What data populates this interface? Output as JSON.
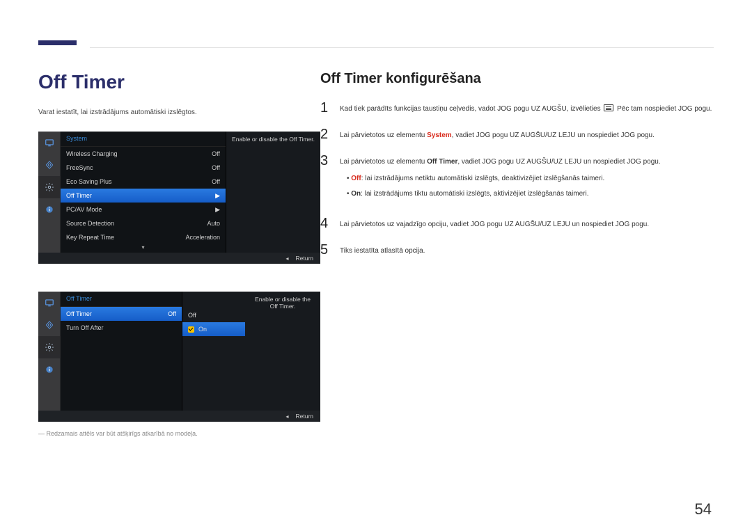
{
  "page": {
    "title": "Off Timer",
    "intro": "Varat iestatīt, lai izstrādājums automātiski izslēgtos.",
    "note": "― Redzamais attēls var būt atšķirīgs atkarībā no modeļa.",
    "page_number": "54"
  },
  "right": {
    "subtitle": "Off Timer konfigurēšana",
    "step1_a": "Kad tiek parādīts funkcijas taustiņu ceļvedis, vadot JOG pogu UZ AUGŠU, izvēlieties ",
    "step1_b": " Pēc tam nospiediet JOG pogu.",
    "step2_a": "Lai pārvietotos uz elementu ",
    "step2_sys": "System",
    "step2_b": ", vadiet JOG pogu UZ AUGŠU/UZ LEJU un nospiediet JOG pogu.",
    "step3_a": "Lai pārvietotos uz elementu ",
    "step3_item": "Off Timer",
    "step3_b": ", vadiet JOG pogu UZ AUGŠU/UZ LEJU un nospiediet JOG pogu.",
    "bullet_off_label": "Off",
    "bullet_off": ": lai izstrādājums netiktu automātiski izslēgts, deaktivizējiet izslēgšanās taimeri.",
    "bullet_on_label": "On",
    "bullet_on": ": lai izstrādājums tiktu automātiski izslēgts, aktivizējiet izslēgšanās taimeri.",
    "step4": "Lai pārvietotos uz vajadzīgo opciju, vadiet JOG pogu UZ AUGŠU/UZ LEJU un nospiediet JOG pogu.",
    "step5": "Tiks iestatīta atlasītā opcija."
  },
  "osd1": {
    "header": "System",
    "desc": "Enable or disable the Off Timer.",
    "items": [
      {
        "label": "Wireless Charging",
        "value": "Off"
      },
      {
        "label": "FreeSync",
        "value": "Off"
      },
      {
        "label": "Eco Saving Plus",
        "value": "Off"
      },
      {
        "label": "Off Timer",
        "value": "▶",
        "selected": true
      },
      {
        "label": "PC/AV Mode",
        "value": "▶"
      },
      {
        "label": "Source Detection",
        "value": "Auto"
      },
      {
        "label": "Key Repeat Time",
        "value": "Acceleration"
      }
    ],
    "return_label": "Return"
  },
  "osd2": {
    "header": "Off Timer",
    "desc": "Enable or disable the Off Timer.",
    "items": [
      {
        "label": "Off Timer",
        "value": "Off",
        "selected": true
      },
      {
        "label": "Turn Off After",
        "value": ""
      }
    ],
    "options": [
      {
        "label": "Off"
      },
      {
        "label": "On",
        "selected": true
      }
    ],
    "return_label": "Return"
  }
}
